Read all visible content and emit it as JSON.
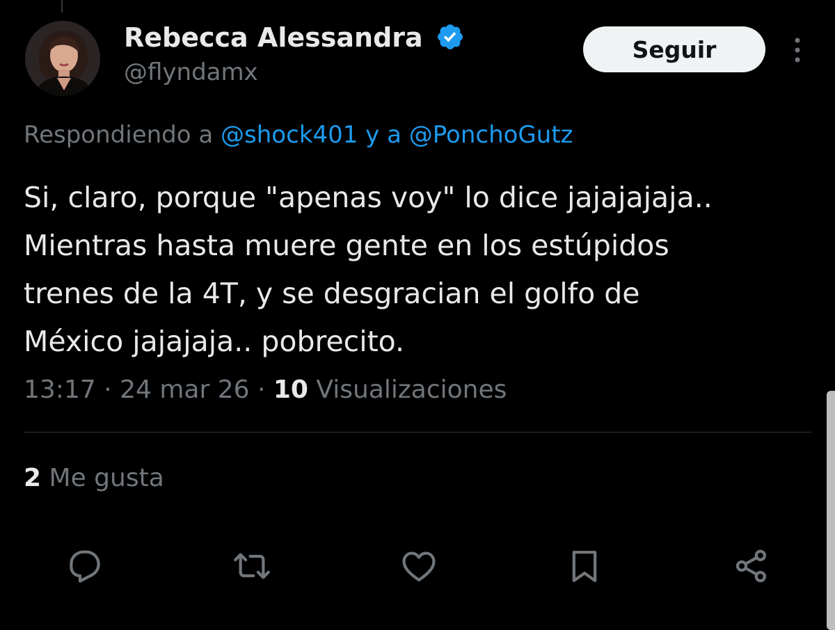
{
  "user": {
    "display_name": "Rebecca Alessandra",
    "handle": "@flyndamx"
  },
  "follow_button": {
    "label": "Seguir"
  },
  "reply_context": {
    "prefix": "Respondiendo a ",
    "mention1": "@shock401",
    "joiner": " y a ",
    "mention2": "@PonchoGutz"
  },
  "tweet": {
    "lines": [
      "Si, claro, porque \"apenas voy\" lo dice jajajajaja..",
      "Mientras hasta muere gente en los estúpidos",
      "trenes de la 4T, y se desgracian el golfo de",
      "México jajajaja.. pobrecito."
    ]
  },
  "meta": {
    "time": "13:17",
    "sep1": " · ",
    "date": "24 mar 26",
    "sep2": " · ",
    "views_count": "10",
    "views_label": " Visualizaciones"
  },
  "likes": {
    "count": "2",
    "label": " Me gusta"
  },
  "actions": [
    {
      "icon": "reply-icon"
    },
    {
      "icon": "retweet-icon"
    },
    {
      "icon": "like-icon"
    },
    {
      "icon": "bookmark-icon"
    },
    {
      "icon": "share-icon"
    }
  ],
  "colors": {
    "background": "#000000",
    "primary_text": "#e7e9ea",
    "secondary_text": "#71767b",
    "link": "#1d9bf0",
    "verified": "#1d9bf0",
    "divider": "#2f3336",
    "button_bg": "#eff3f4"
  }
}
